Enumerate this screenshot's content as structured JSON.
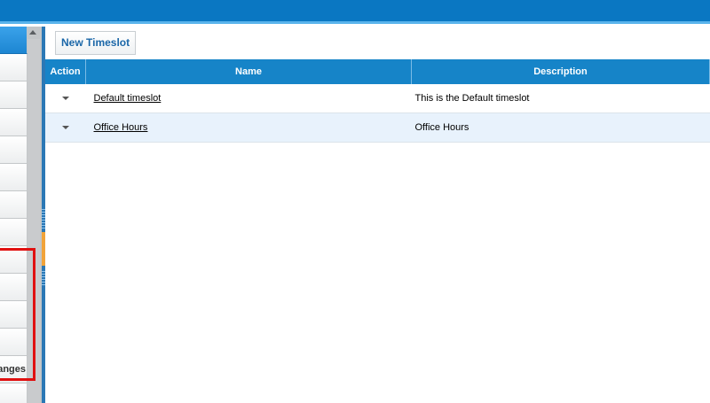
{
  "sidebar": {
    "partial_item_text": "anges"
  },
  "toolbar": {
    "new_button_label": "New Timeslot"
  },
  "grid": {
    "columns": [
      "Action",
      "Name",
      "Description"
    ],
    "rows": [
      {
        "name": "Default timeslot",
        "description": "This is the Default timeslot"
      },
      {
        "name": "Office Hours",
        "description": "Office Hours"
      }
    ]
  },
  "colors": {
    "header_blue": "#1684c8",
    "topbar_blue": "#0a77c2",
    "highlight_red": "#e01010",
    "splitter_orange": "#f1a33a"
  }
}
